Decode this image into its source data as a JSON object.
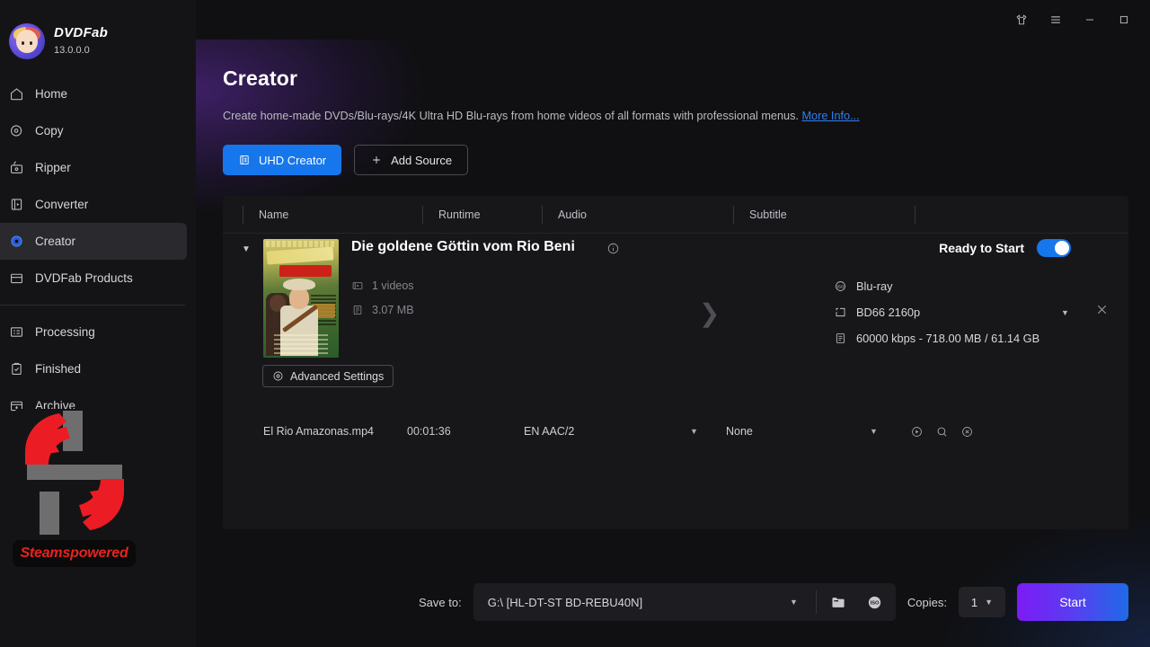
{
  "app": {
    "brand_name": "DVDFab",
    "version": "13.0.0.0"
  },
  "titlebar": {
    "theme_icon": "tshirt-icon",
    "menu_icon": "hamburger-menu-icon",
    "minimize_icon": "minimize-icon",
    "maximize_icon": "maximize-icon"
  },
  "sidebar": {
    "items": [
      {
        "label": "Home",
        "icon": "home-icon",
        "active": false
      },
      {
        "label": "Copy",
        "icon": "disc-copy-icon",
        "active": false
      },
      {
        "label": "Ripper",
        "icon": "ripper-icon",
        "active": false
      },
      {
        "label": "Converter",
        "icon": "converter-icon",
        "active": false
      },
      {
        "label": "Creator",
        "icon": "creator-disc-icon",
        "active": true
      },
      {
        "label": "DVDFab Products",
        "icon": "products-box-icon",
        "active": false
      },
      {
        "label": "Processing",
        "icon": "processing-icon",
        "active": false
      },
      {
        "label": "Finished",
        "icon": "finished-clipboard-icon",
        "active": false
      },
      {
        "label": "Archive",
        "icon": "archive-box-icon",
        "active": false
      }
    ],
    "watermark": {
      "label": "Steamspowered",
      "icon": "gear-crack-icon",
      "color": "#e8231f"
    }
  },
  "page": {
    "title": "Creator",
    "description": "Create home-made DVDs/Blu-rays/4K Ultra HD Blu-rays from home videos of all formats with professional menus.",
    "more_info": "More Info...",
    "buttons": {
      "uhd_creator": "UHD Creator",
      "add_source": "Add Source"
    },
    "accent_blue": "#1677ec"
  },
  "table": {
    "headers": [
      "Name",
      "Runtime",
      "Audio",
      "Subtitle",
      ""
    ],
    "row": {
      "caret": "▼",
      "title": "Die goldene Göttin vom Rio Beni",
      "info_icon": "info-icon",
      "videos_count": "1 videos",
      "size": "3.07 MB",
      "advanced_settings": "Advanced Settings",
      "status_label": "Ready to Start",
      "toggle_on": true,
      "output": {
        "format": "Blu-ray",
        "quality": "BD66 2160p",
        "bitrate": "60000 kbps - 718.00 MB / 61.14 GB"
      },
      "file": {
        "name": "El Rio Amazonas.mp4",
        "runtime": "00:01:36",
        "audio": "EN  AAC/2",
        "subtitle": "None",
        "icons": [
          "play-circle-icon",
          "search-icon",
          "remove-circle-icon"
        ]
      }
    }
  },
  "bottom": {
    "save_to_label": "Save to:",
    "save_to_value": "G:\\ [HL-DT-ST BD-REBU40N]",
    "folder_icon": "folder-icon",
    "iso_icon": "iso-icon",
    "copies_label": "Copies:",
    "copies_value": "1",
    "start_label": "Start"
  }
}
